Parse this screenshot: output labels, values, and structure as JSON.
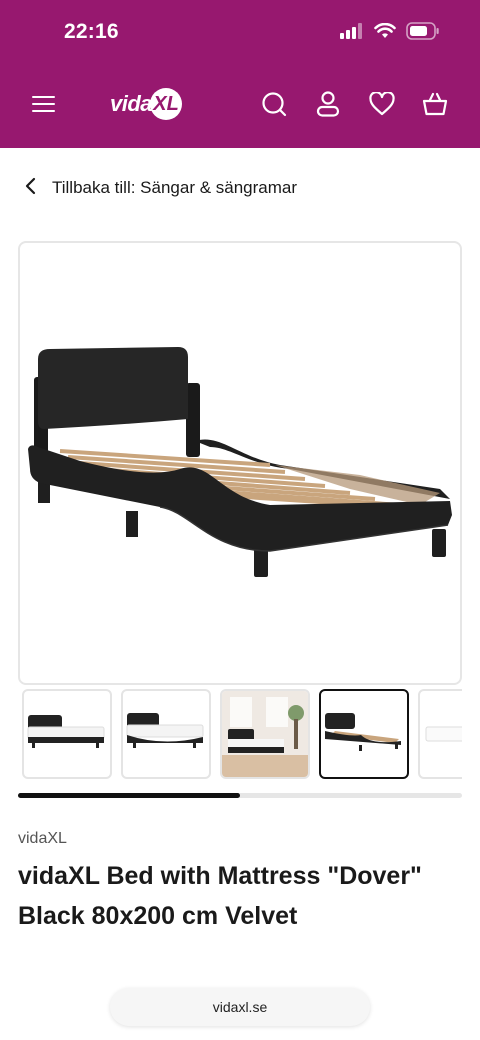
{
  "status_bar": {
    "time": "22:16"
  },
  "header": {
    "background": "#97186f",
    "logo_text": "vida",
    "logo_badge": "XL",
    "icons": [
      "menu-icon",
      "search-icon",
      "user-icon",
      "heart-icon",
      "basket-icon"
    ]
  },
  "breadcrumb": {
    "label": "Tillbaka till: Sängar & sängramar"
  },
  "gallery": {
    "thumbnail_count": 5,
    "active_thumbnail": 4,
    "scroll_progress": 0.5
  },
  "product": {
    "brand": "vidaXL",
    "title": "vidaXL Bed with Mattress \"Dover\" Black 80x200 cm Velvet"
  },
  "browser": {
    "url": "vidaxl.se"
  }
}
